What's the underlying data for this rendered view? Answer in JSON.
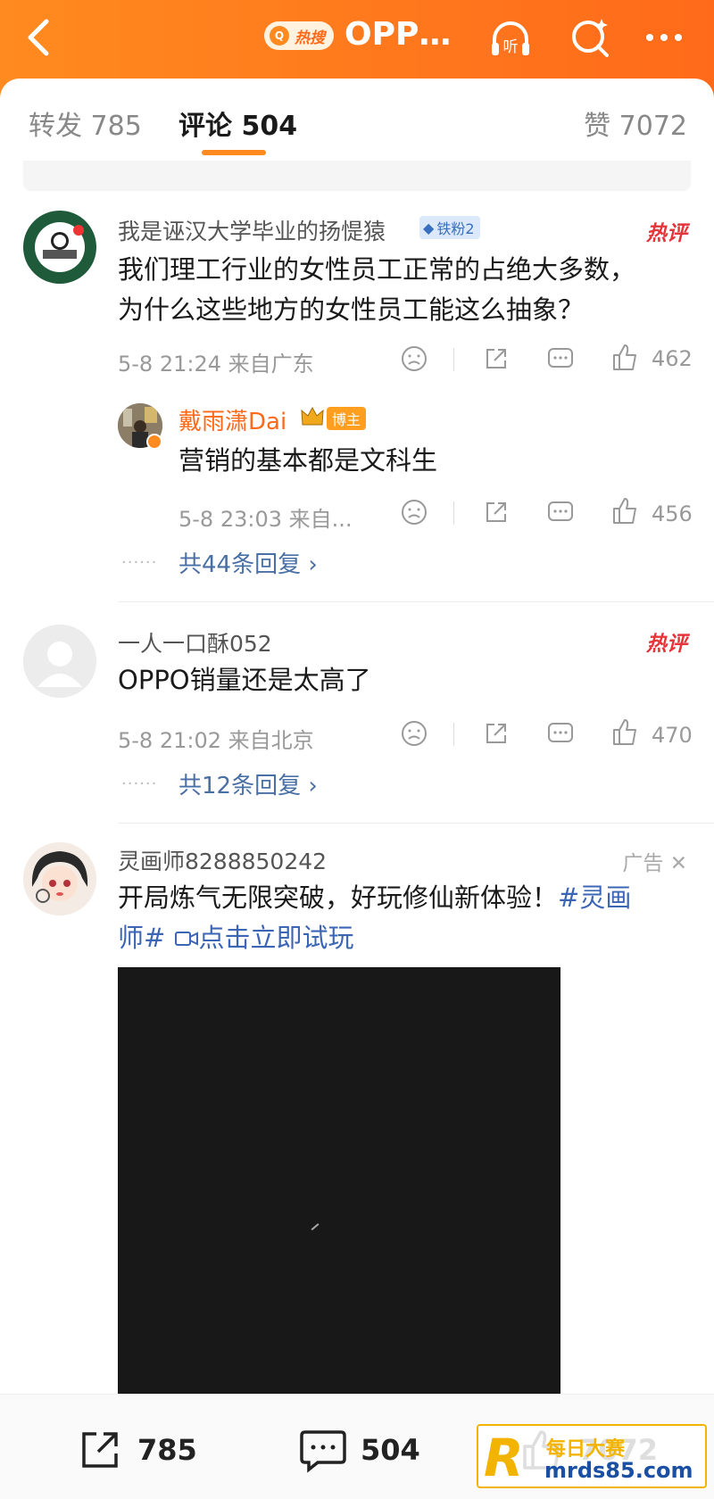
{
  "header": {
    "hot_label": "热搜",
    "title": "OPP…",
    "listen_label": "听"
  },
  "tabs": {
    "repost": "转发 785",
    "comment": "评论 504",
    "like": "赞 7072"
  },
  "notice": "",
  "comments": [
    {
      "username": "我是诬汉大学毕业的扬惿猿",
      "badge": "铁粉2",
      "hot_label": "热评",
      "text_line1": "我们理工行业的女性员工正常的占绝大多数，",
      "text_line2": "为什么这些地方的女性员工能这么抽象？",
      "meta": "5-8 21:24 来自广东",
      "likes": "462",
      "reply": {
        "username": "戴雨潇Dai",
        "badge": "博主",
        "text": "营销的基本都是文科生",
        "meta": "5-8 23:03 来自...",
        "likes": "456"
      },
      "more": "共44条回复 ›"
    },
    {
      "username": "一人一口酥052",
      "hot_label": "热评",
      "text": "OPPO销量还是太高了",
      "meta": "5-8 21:02 来自北京",
      "likes": "470",
      "more": "共12条回复 ›"
    }
  ],
  "ad": {
    "username": "灵画师8288850242",
    "label": "广告 ✕",
    "text_line1_a": "开局炼气无限突破，好玩修仙新体验！",
    "text_line1_topic": "#灵画",
    "text_line2_topic": "师#",
    "text_line2_link": "点击立即试玩"
  },
  "bottom_bar": {
    "repost": "785",
    "comment": "504",
    "like": "7072"
  },
  "watermark": {
    "top": "每日大赛",
    "url": "mrds85.com"
  },
  "colors": {
    "header_orange": "#ff7a1c",
    "hot_red": "#e6343a",
    "link_blue": "#3c66b5"
  }
}
